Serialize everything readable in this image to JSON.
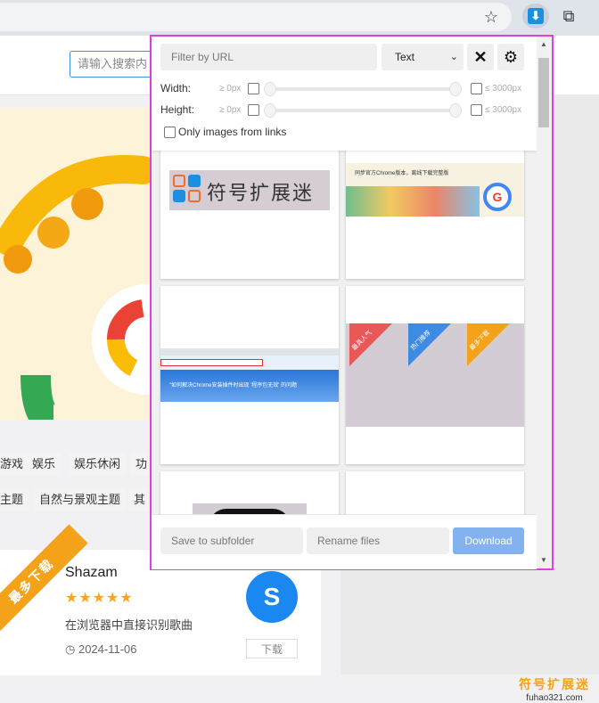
{
  "browser": {
    "star_icon": "star-icon",
    "download_icon": "download-icon",
    "extensions_icon": "puzzle-icon"
  },
  "site": {
    "search_placeholder": "请输入搜索内",
    "tags": [
      "游戏",
      "娱乐",
      "娱乐休闲",
      "功",
      "主题",
      "自然与景观主题",
      "其"
    ],
    "card": {
      "ribbon": "最多下载",
      "name": "Shazam",
      "stars": "★★★★★",
      "rating": 5,
      "description": "在浏览器中直接识别歌曲",
      "date": "2024-11-06",
      "get_button": "下载"
    },
    "watermark_cn": "符号扩展迷",
    "watermark_url": "fuhao321.com"
  },
  "popup": {
    "filter_placeholder": "Filter by URL",
    "filter_type": "Text",
    "close_icon": "x-icon",
    "settings_icon": "gear-icon",
    "width_label": "Width:",
    "height_label": "Height:",
    "min_label": "≥ 0px",
    "max_label": "≤ 3000px",
    "only_links_label": "Only images from links",
    "tiles": {
      "t1_text": "符号扩展迷",
      "t2_title": "同步官方Chrome版本，离线下载完整版",
      "t3_text": "\"如何解决Chrome安装插件时出现 '程序包无效' 的问题",
      "t4_labels": [
        "最具人气",
        "热门推荐",
        "最多下载"
      ]
    },
    "save_placeholder": "Save to subfolder",
    "rename_placeholder": "Rename files",
    "download_label": "Download"
  }
}
